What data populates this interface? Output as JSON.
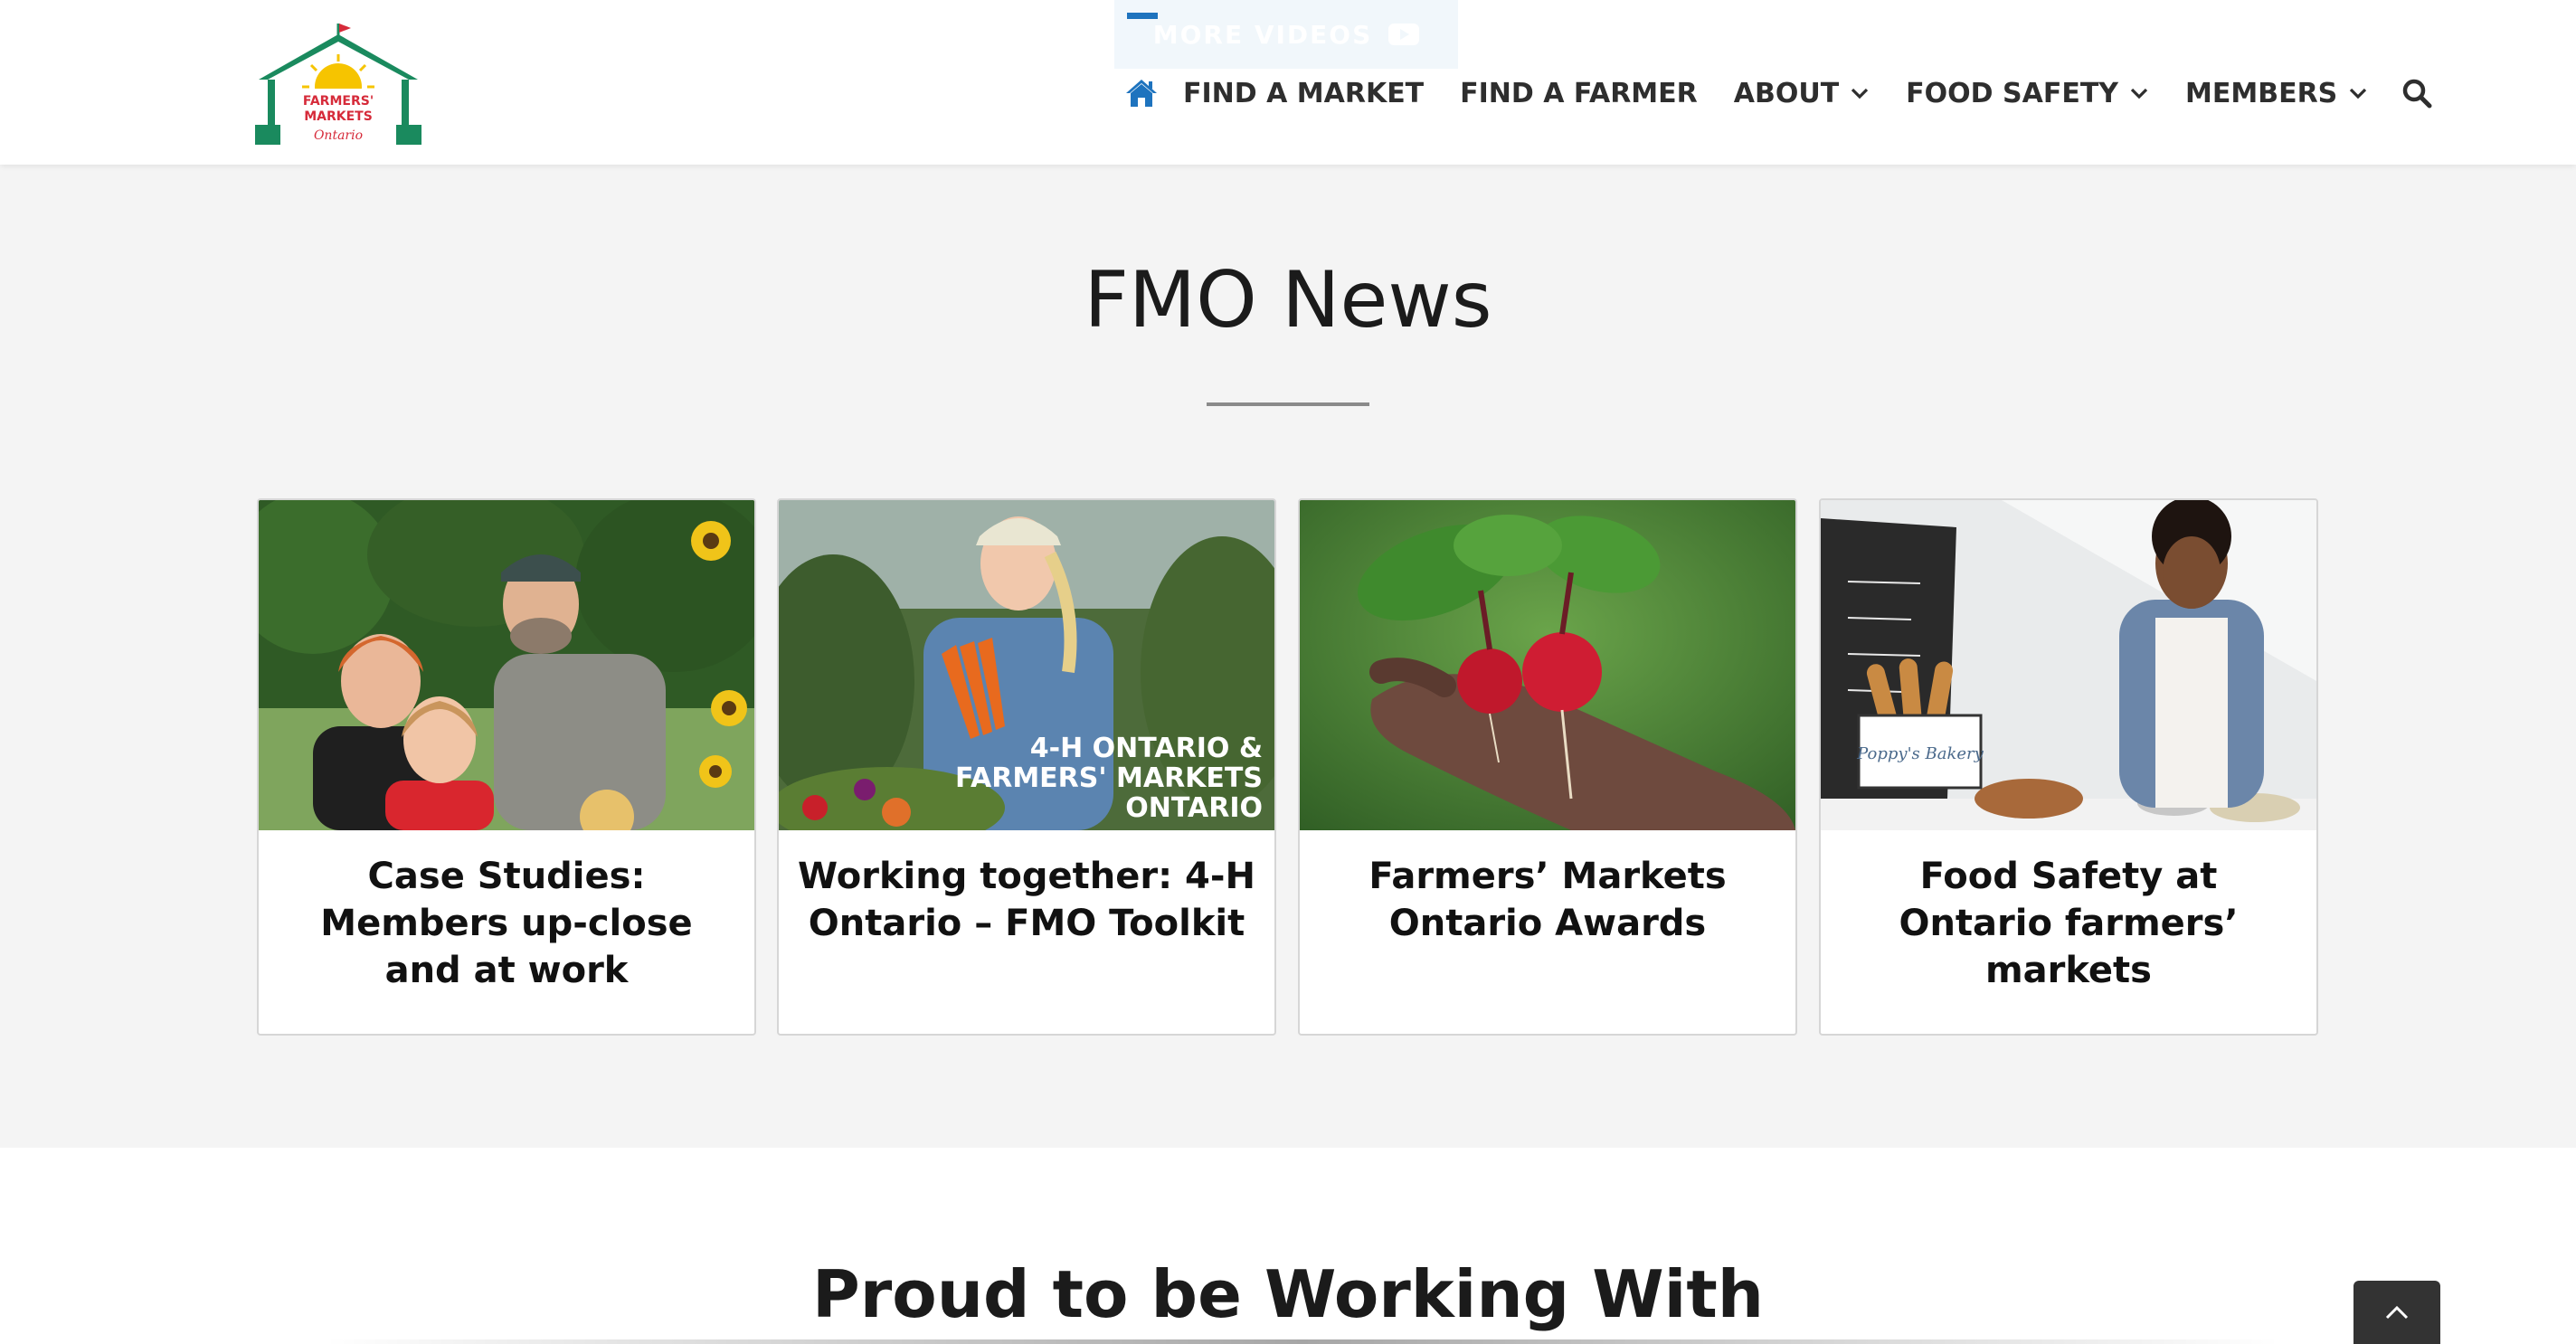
{
  "header": {
    "logo": {
      "alt": "Farmers' Markets Ontario logo",
      "line1": "FARMERS'",
      "line2": "MARKETS",
      "script": "Ontario"
    },
    "more_videos_label": "MORE VIDEOS",
    "nav": {
      "home_icon": "home-icon",
      "items": [
        {
          "label": "FIND A MARKET",
          "dropdown": false
        },
        {
          "label": "FIND A FARMER",
          "dropdown": false
        },
        {
          "label": "ABOUT",
          "dropdown": true
        },
        {
          "label": "FOOD SAFETY",
          "dropdown": true
        },
        {
          "label": "MEMBERS",
          "dropdown": true
        }
      ],
      "search_icon": "search-icon"
    }
  },
  "news": {
    "title": "FMO News",
    "cards": [
      {
        "title": "Case Studies: Members up-close and at work",
        "image": "family-with-sunflowers"
      },
      {
        "title": "Working together: 4-H Ontario – FMO Toolkit",
        "image": "girl-with-carrots",
        "overlay_line1": "4-H ONTARIO &",
        "overlay_line2": "FARMERS' MARKETS",
        "overlay_line3": "ONTARIO"
      },
      {
        "title": "Farmers’ Markets Ontario Awards",
        "image": "hand-holding-radishes"
      },
      {
        "title": "Food Safety at Ontario farmers’ markets",
        "image": "bakery-vendor",
        "sign_text": "Poppy's Bakery"
      }
    ]
  },
  "partners": {
    "title": "Proud to be Working With"
  },
  "colors": {
    "accent": "#1e73be",
    "section_bg": "#f4f4f4",
    "logo_green": "#1a8a5e",
    "logo_red": "#d62b3a",
    "logo_yellow": "#f6c400"
  },
  "back_to_top_icon": "chevron-up-icon"
}
